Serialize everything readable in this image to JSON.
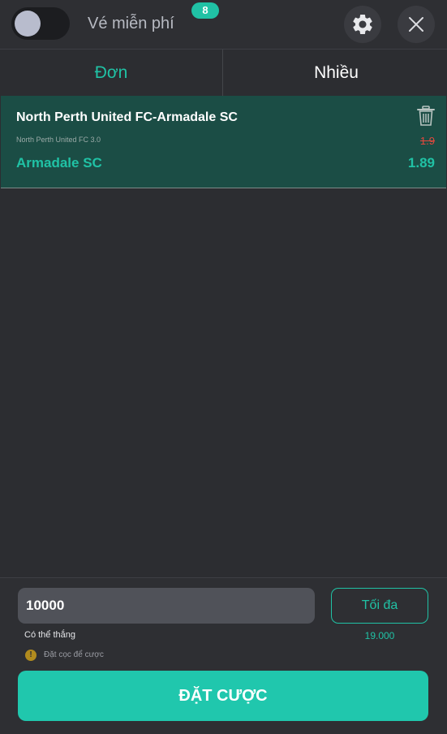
{
  "header": {
    "free_ticket_label": "Vé miễn phí",
    "badge_count": "8",
    "toggle_on": false
  },
  "tabs": [
    {
      "label": "Đơn",
      "active": true
    },
    {
      "label": "Nhiều",
      "active": false
    }
  ],
  "bet": {
    "match": "North Perth United FC-Armadale SC",
    "sub_line": "North Perth United FC  3.0",
    "old_odds": "1.9",
    "selection": "Armadale SC",
    "odds": "1.89"
  },
  "footer": {
    "stake_value": "10000",
    "max_label": "Tối đa",
    "possible_win_label": "Có thể thắng",
    "possible_win_value": "19.000",
    "note_icon": "!",
    "note_text": "Đặt cọc để cược",
    "place_bet_label": "ĐẶT CƯỢC"
  },
  "colors": {
    "accent": "#20c2a5",
    "card_bg": "#1b4d45",
    "strike_red": "#e5483d",
    "warning": "#b18b1e"
  },
  "icons": {
    "gear": "gear-icon",
    "close": "close-icon",
    "trash": "trash-icon",
    "warning": "warning-icon"
  }
}
